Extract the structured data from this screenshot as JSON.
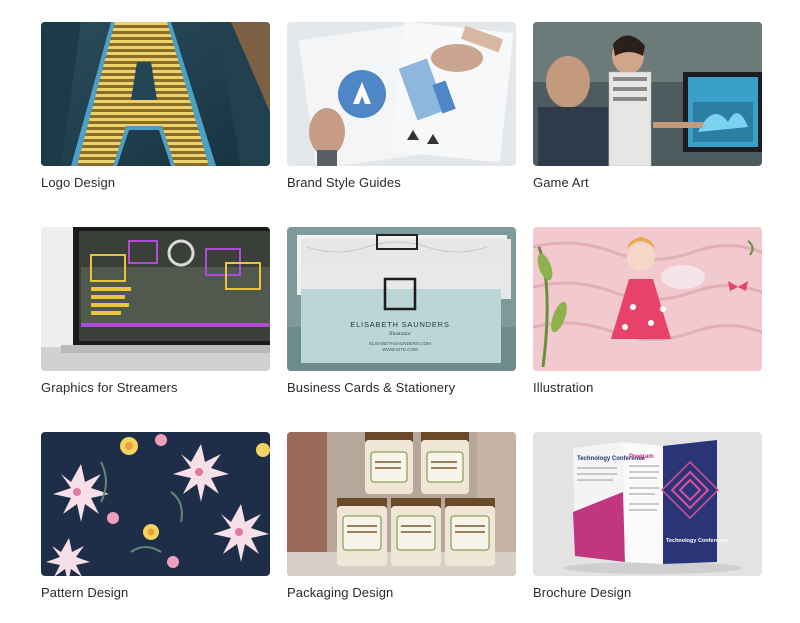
{
  "categories": [
    {
      "label": "Logo Design",
      "image": "logo-design-image"
    },
    {
      "label": "Brand Style Guides",
      "image": "brand-style-guides-image"
    },
    {
      "label": "Game Art",
      "image": "game-art-image"
    },
    {
      "label": "Graphics for Streamers",
      "image": "graphics-for-streamers-image"
    },
    {
      "label": "Business Cards & Stationery",
      "image": "business-cards-image",
      "card_text": {
        "name": "ELISABETH SAUNDERS",
        "role": "Illustrator",
        "email": "ELISABETHSAUNDERS.COM",
        "site": "WWW.SITE.COM"
      }
    },
    {
      "label": "Illustration",
      "image": "illustration-image"
    },
    {
      "label": "Pattern Design",
      "image": "pattern-design-image"
    },
    {
      "label": "Packaging Design",
      "image": "packaging-design-image"
    },
    {
      "label": "Brochure Design",
      "image": "brochure-design-image",
      "brochure_text": {
        "left_title": "Technology Conference",
        "mid_title": "Program",
        "right_title": "Technology Conference"
      }
    }
  ],
  "colors": {
    "text": "#2b2b2b",
    "background": "#ffffff"
  }
}
